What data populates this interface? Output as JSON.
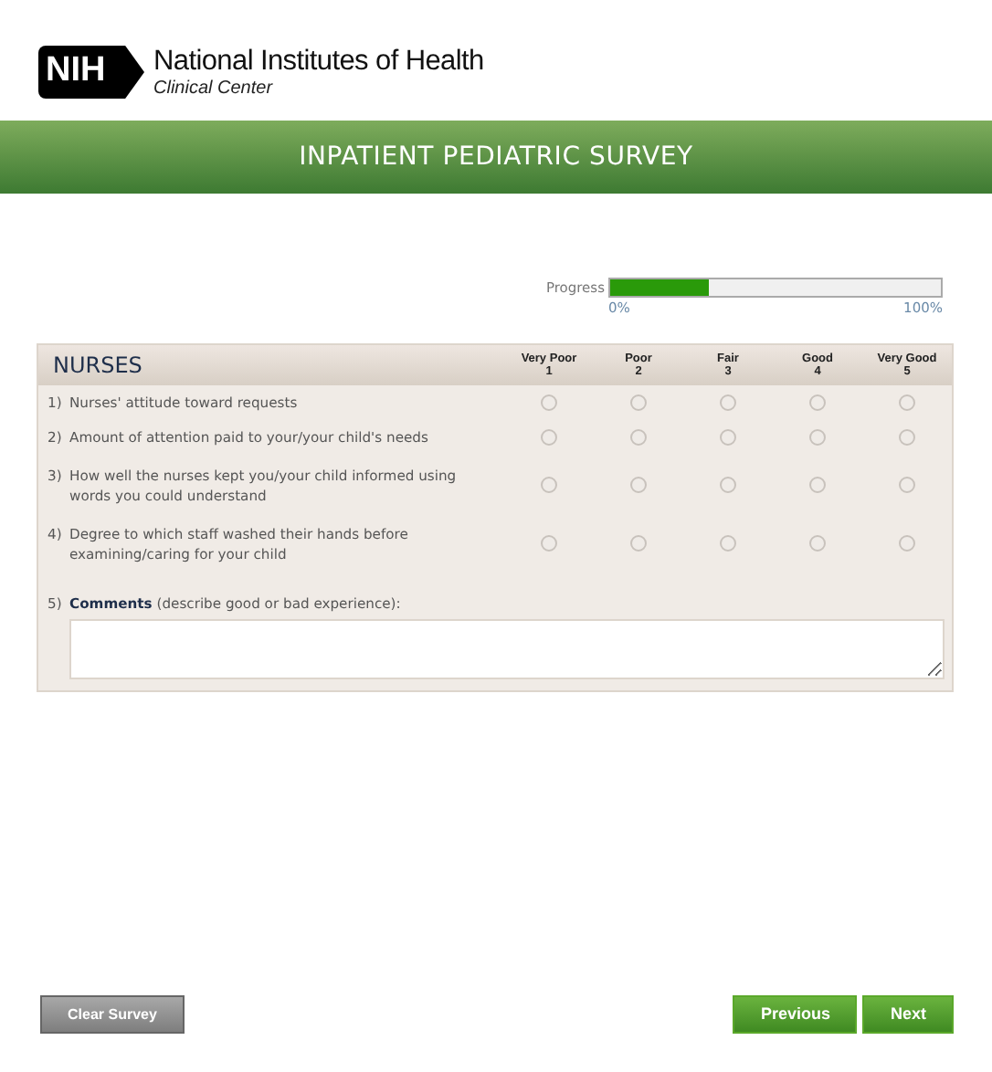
{
  "logo": {
    "mark": "NIH",
    "name": "National Institutes of Health",
    "subtitle": "Clinical Center"
  },
  "title": "INPATIENT PEDIATRIC SURVEY",
  "progress": {
    "label": "Progress",
    "level": 0.3,
    "min_label": "0%",
    "max_label": "100%"
  },
  "section": {
    "title": "NURSES",
    "scale": [
      {
        "label": "Very Poor",
        "value": "1"
      },
      {
        "label": "Poor",
        "value": "2"
      },
      {
        "label": "Fair",
        "value": "3"
      },
      {
        "label": "Good",
        "value": "4"
      },
      {
        "label": "Very Good",
        "value": "5"
      }
    ],
    "questions": [
      {
        "number": "1)",
        "text": "Nurses' attitude toward requests",
        "ratings": [
          {
            "selected": false
          },
          {
            "selected": false
          },
          {
            "selected": false
          },
          {
            "selected": false
          },
          {
            "selected": false
          }
        ]
      },
      {
        "number": "2)",
        "text": "Amount of attention paid to your/your child's needs",
        "ratings": [
          {
            "selected": false
          },
          {
            "selected": false
          },
          {
            "selected": false
          },
          {
            "selected": false
          },
          {
            "selected": false
          }
        ]
      },
      {
        "number": "3)",
        "text": "How well the nurses kept you/your child informed using words you could understand",
        "ratings": [
          {
            "selected": false
          },
          {
            "selected": false
          },
          {
            "selected": false
          },
          {
            "selected": false
          },
          {
            "selected": false
          }
        ]
      },
      {
        "number": "4)",
        "text": "Degree to which staff washed their hands before examining/caring for your child",
        "ratings": [
          {
            "selected": false
          },
          {
            "selected": false
          },
          {
            "selected": false
          },
          {
            "selected": false
          },
          {
            "selected": false
          }
        ]
      }
    ],
    "comment": {
      "number": "5)",
      "label": "**Comments** (describe good or bad experience):"
    }
  },
  "buttons": [
    {
      "label": "Clear Survey",
      "kind": "clear"
    },
    {
      "label": "Previous",
      "kind": "nav"
    },
    {
      "label": "Next",
      "kind": "nav"
    }
  ]
}
